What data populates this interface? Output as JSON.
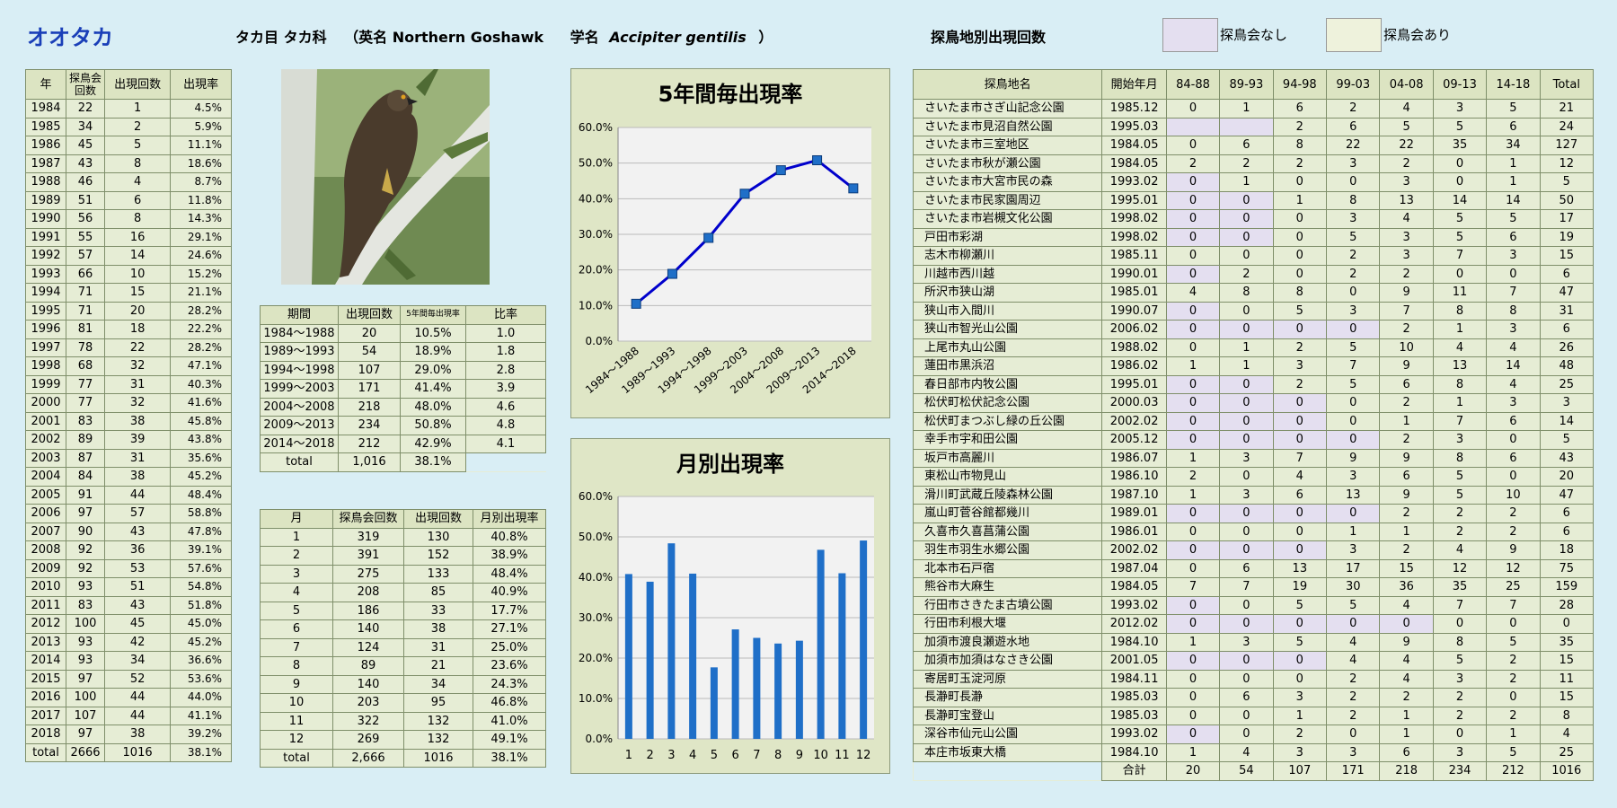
{
  "species": {
    "name": "オオタカ",
    "order_family": "タカ目 タカ科",
    "english_prefix": "（英名 ",
    "english": "Northern Goshawk",
    "latin_prefix": "学名",
    "latin": "Accipiter gentilis",
    "latin_suffix": "）"
  },
  "site_section_title": "探鳥地別出現回数",
  "legend": {
    "no_session": "探鳥会なし",
    "with_session": "探鳥会あり",
    "no_session_color": "#e4dff0",
    "with_session_color": "#eef2dc"
  },
  "yearly": {
    "headers": [
      "年",
      "探鳥会回数",
      "出現回数",
      "出現率"
    ],
    "rows": [
      [
        "1984",
        "22",
        "1",
        "4.5%"
      ],
      [
        "1985",
        "34",
        "2",
        "5.9%"
      ],
      [
        "1986",
        "45",
        "5",
        "11.1%"
      ],
      [
        "1987",
        "43",
        "8",
        "18.6%"
      ],
      [
        "1988",
        "46",
        "4",
        "8.7%"
      ],
      [
        "1989",
        "51",
        "6",
        "11.8%"
      ],
      [
        "1990",
        "56",
        "8",
        "14.3%"
      ],
      [
        "1991",
        "55",
        "16",
        "29.1%"
      ],
      [
        "1992",
        "57",
        "14",
        "24.6%"
      ],
      [
        "1993",
        "66",
        "10",
        "15.2%"
      ],
      [
        "1994",
        "71",
        "15",
        "21.1%"
      ],
      [
        "1995",
        "71",
        "20",
        "28.2%"
      ],
      [
        "1996",
        "81",
        "18",
        "22.2%"
      ],
      [
        "1997",
        "78",
        "22",
        "28.2%"
      ],
      [
        "1998",
        "68",
        "32",
        "47.1%"
      ],
      [
        "1999",
        "77",
        "31",
        "40.3%"
      ],
      [
        "2000",
        "77",
        "32",
        "41.6%"
      ],
      [
        "2001",
        "83",
        "38",
        "45.8%"
      ],
      [
        "2002",
        "89",
        "39",
        "43.8%"
      ],
      [
        "2003",
        "87",
        "31",
        "35.6%"
      ],
      [
        "2004",
        "84",
        "38",
        "45.2%"
      ],
      [
        "2005",
        "91",
        "44",
        "48.4%"
      ],
      [
        "2006",
        "97",
        "57",
        "58.8%"
      ],
      [
        "2007",
        "90",
        "43",
        "47.8%"
      ],
      [
        "2008",
        "92",
        "36",
        "39.1%"
      ],
      [
        "2009",
        "92",
        "53",
        "57.6%"
      ],
      [
        "2010",
        "93",
        "51",
        "54.8%"
      ],
      [
        "2011",
        "83",
        "43",
        "51.8%"
      ],
      [
        "2012",
        "100",
        "45",
        "45.0%"
      ],
      [
        "2013",
        "93",
        "42",
        "45.2%"
      ],
      [
        "2014",
        "93",
        "34",
        "36.6%"
      ],
      [
        "2015",
        "97",
        "52",
        "53.6%"
      ],
      [
        "2016",
        "100",
        "44",
        "44.0%"
      ],
      [
        "2017",
        "107",
        "44",
        "41.1%"
      ],
      [
        "2018",
        "97",
        "38",
        "39.2%"
      ],
      [
        "total",
        "2666",
        "1016",
        "38.1%"
      ]
    ]
  },
  "period": {
    "headers": [
      "期間",
      "出現回数",
      "5年間毎出現率",
      "比率"
    ],
    "rows": [
      [
        "1984～1988",
        "20",
        "10.5%",
        "1.0"
      ],
      [
        "1989～1993",
        "54",
        "18.9%",
        "1.8"
      ],
      [
        "1994～1998",
        "107",
        "29.0%",
        "2.8"
      ],
      [
        "1999～2003",
        "171",
        "41.4%",
        "3.9"
      ],
      [
        "2004～2008",
        "218",
        "48.0%",
        "4.6"
      ],
      [
        "2009～2013",
        "234",
        "50.8%",
        "4.8"
      ],
      [
        "2014～2018",
        "212",
        "42.9%",
        "4.1"
      ]
    ],
    "total": [
      "total",
      "1,016",
      "38.1%"
    ]
  },
  "monthly": {
    "headers": [
      "月",
      "探鳥会回数",
      "出現回数",
      "月別出現率"
    ],
    "rows": [
      [
        "1",
        "319",
        "130",
        "40.8%"
      ],
      [
        "2",
        "391",
        "152",
        "38.9%"
      ],
      [
        "3",
        "275",
        "133",
        "48.4%"
      ],
      [
        "4",
        "208",
        "85",
        "40.9%"
      ],
      [
        "5",
        "186",
        "33",
        "17.7%"
      ],
      [
        "6",
        "140",
        "38",
        "27.1%"
      ],
      [
        "7",
        "124",
        "31",
        "25.0%"
      ],
      [
        "8",
        "89",
        "21",
        "23.6%"
      ],
      [
        "9",
        "140",
        "34",
        "24.3%"
      ],
      [
        "10",
        "203",
        "95",
        "46.8%"
      ],
      [
        "11",
        "322",
        "132",
        "41.0%"
      ],
      [
        "12",
        "269",
        "132",
        "49.1%"
      ],
      [
        "total",
        "2,666",
        "1016",
        "38.1%"
      ]
    ]
  },
  "chart_data": [
    {
      "type": "line",
      "title": "5年間毎出現率",
      "categories": [
        "1984～1988",
        "1989～1993",
        "1994～1998",
        "1999～2003",
        "2004～2008",
        "2009～2013",
        "2014～2018"
      ],
      "values": [
        10.5,
        18.9,
        29.0,
        41.4,
        48.0,
        50.8,
        42.9
      ],
      "ylim": [
        0,
        60
      ],
      "yticks": [
        "0.0%",
        "10.0%",
        "20.0%",
        "30.0%",
        "40.0%",
        "50.0%",
        "60.0%"
      ],
      "color": "#0000cc",
      "marker_color": "#1f6fc8",
      "grid": true
    },
    {
      "type": "bar",
      "title": "月別出現率",
      "categories": [
        "1",
        "2",
        "3",
        "4",
        "5",
        "6",
        "7",
        "8",
        "9",
        "10",
        "11",
        "12"
      ],
      "values": [
        40.8,
        38.9,
        48.4,
        40.9,
        17.7,
        27.1,
        25.0,
        23.6,
        24.3,
        46.8,
        41.0,
        49.1
      ],
      "ylim": [
        0,
        60
      ],
      "yticks": [
        "0.0%",
        "10.0%",
        "20.0%",
        "30.0%",
        "40.0%",
        "50.0%",
        "60.0%"
      ],
      "color": "#1f6fc8",
      "grid": true
    }
  ],
  "sites": {
    "headers": [
      "探鳥地名",
      "開始年月",
      "84-88",
      "89-93",
      "94-98",
      "99-03",
      "04-08",
      "09-13",
      "14-18",
      "Total"
    ],
    "rows": [
      {
        "name": "さいたま市さぎ山記念公園",
        "start": "1985.12",
        "v": [
          "0",
          "1",
          "6",
          "2",
          "4",
          "3",
          "5",
          "21"
        ],
        "none": []
      },
      {
        "name": "さいたま市見沼自然公園",
        "start": "1995.03",
        "v": [
          "",
          "",
          "2",
          "6",
          "5",
          "5",
          "6",
          "24"
        ],
        "none": [
          0,
          1
        ]
      },
      {
        "name": "さいたま市三室地区",
        "start": "1984.05",
        "v": [
          "0",
          "6",
          "8",
          "22",
          "22",
          "35",
          "34",
          "127"
        ],
        "none": []
      },
      {
        "name": "さいたま市秋が瀬公園",
        "start": "1984.05",
        "v": [
          "2",
          "2",
          "2",
          "3",
          "2",
          "0",
          "1",
          "12"
        ],
        "none": []
      },
      {
        "name": "さいたま市大宮市民の森",
        "start": "1993.02",
        "v": [
          "0",
          "1",
          "0",
          "0",
          "3",
          "0",
          "1",
          "5"
        ],
        "none": [
          0
        ]
      },
      {
        "name": "さいたま市民家園周辺",
        "start": "1995.01",
        "v": [
          "0",
          "0",
          "1",
          "8",
          "13",
          "14",
          "14",
          "50"
        ],
        "none": [
          0,
          1
        ]
      },
      {
        "name": "さいたま市岩槻文化公園",
        "start": "1998.02",
        "v": [
          "0",
          "0",
          "0",
          "3",
          "4",
          "5",
          "5",
          "17"
        ],
        "none": [
          0,
          1
        ]
      },
      {
        "name": "戸田市彩湖",
        "start": "1998.02",
        "v": [
          "0",
          "0",
          "0",
          "5",
          "3",
          "5",
          "6",
          "19"
        ],
        "none": [
          0,
          1
        ]
      },
      {
        "name": "志木市柳瀬川",
        "start": "1985.11",
        "v": [
          "0",
          "0",
          "0",
          "2",
          "3",
          "7",
          "3",
          "15"
        ],
        "none": []
      },
      {
        "name": "川越市西川越",
        "start": "1990.01",
        "v": [
          "0",
          "2",
          "0",
          "2",
          "2",
          "0",
          "0",
          "6"
        ],
        "none": [
          0
        ]
      },
      {
        "name": "所沢市狭山湖",
        "start": "1985.01",
        "v": [
          "4",
          "8",
          "8",
          "0",
          "9",
          "11",
          "7",
          "47"
        ],
        "none": []
      },
      {
        "name": "狭山市入間川",
        "start": "1990.07",
        "v": [
          "0",
          "0",
          "5",
          "3",
          "7",
          "8",
          "8",
          "31"
        ],
        "none": [
          0
        ]
      },
      {
        "name": "狭山市智光山公園",
        "start": "2006.02",
        "v": [
          "0",
          "0",
          "0",
          "0",
          "2",
          "1",
          "3",
          "6"
        ],
        "none": [
          0,
          1,
          2,
          3
        ]
      },
      {
        "name": "上尾市丸山公園",
        "start": "1988.02",
        "v": [
          "0",
          "1",
          "2",
          "5",
          "10",
          "4",
          "4",
          "26"
        ],
        "none": []
      },
      {
        "name": "蓮田市黒浜沼",
        "start": "1986.02",
        "v": [
          "1",
          "1",
          "3",
          "7",
          "9",
          "13",
          "14",
          "48"
        ],
        "none": []
      },
      {
        "name": "春日部市内牧公園",
        "start": "1995.01",
        "v": [
          "0",
          "0",
          "2",
          "5",
          "6",
          "8",
          "4",
          "25"
        ],
        "none": [
          0,
          1
        ]
      },
      {
        "name": "松伏町松伏記念公園",
        "start": "2000.03",
        "v": [
          "0",
          "0",
          "0",
          "0",
          "2",
          "1",
          "3",
          "3"
        ],
        "none": [
          0,
          1,
          2
        ]
      },
      {
        "name": "松伏町まつぶし緑の丘公園",
        "start": "2002.02",
        "v": [
          "0",
          "0",
          "0",
          "0",
          "1",
          "7",
          "6",
          "14"
        ],
        "none": [
          0,
          1,
          2
        ]
      },
      {
        "name": "幸手市宇和田公園",
        "start": "2005.12",
        "v": [
          "0",
          "0",
          "0",
          "0",
          "2",
          "3",
          "0",
          "5"
        ],
        "none": [
          0,
          1,
          2,
          3
        ]
      },
      {
        "name": "坂戸市高麗川",
        "start": "1986.07",
        "v": [
          "1",
          "3",
          "7",
          "9",
          "9",
          "8",
          "6",
          "43"
        ],
        "none": []
      },
      {
        "name": "東松山市物見山",
        "start": "1986.10",
        "v": [
          "2",
          "0",
          "4",
          "3",
          "6",
          "5",
          "0",
          "20"
        ],
        "none": []
      },
      {
        "name": "滑川町武蔵丘陵森林公園",
        "start": "1987.10",
        "v": [
          "1",
          "3",
          "6",
          "13",
          "9",
          "5",
          "10",
          "47"
        ],
        "none": []
      },
      {
        "name": "嵐山町菅谷館都幾川",
        "start": "1989.01",
        "v": [
          "0",
          "0",
          "0",
          "0",
          "2",
          "2",
          "2",
          "6"
        ],
        "none": [
          0,
          1,
          2,
          3
        ]
      },
      {
        "name": "久喜市久喜菖蒲公園",
        "start": "1986.01",
        "v": [
          "0",
          "0",
          "0",
          "1",
          "1",
          "2",
          "2",
          "6"
        ],
        "none": []
      },
      {
        "name": "羽生市羽生水郷公園",
        "start": "2002.02",
        "v": [
          "0",
          "0",
          "0",
          "3",
          "2",
          "4",
          "9",
          "18"
        ],
        "none": [
          0,
          1,
          2
        ]
      },
      {
        "name": "北本市石戸宿",
        "start": "1987.04",
        "v": [
          "0",
          "6",
          "13",
          "17",
          "15",
          "12",
          "12",
          "75"
        ],
        "none": []
      },
      {
        "name": "熊谷市大麻生",
        "start": "1984.05",
        "v": [
          "7",
          "7",
          "19",
          "30",
          "36",
          "35",
          "25",
          "159"
        ],
        "none": []
      },
      {
        "name": "行田市さきたま古墳公園",
        "start": "1993.02",
        "v": [
          "0",
          "0",
          "5",
          "5",
          "4",
          "7",
          "7",
          "28"
        ],
        "none": [
          0
        ]
      },
      {
        "name": "行田市利根大堰",
        "start": "2012.02",
        "v": [
          "0",
          "0",
          "0",
          "0",
          "0",
          "0",
          "0",
          "0"
        ],
        "none": [
          0,
          1,
          2,
          3,
          4
        ]
      },
      {
        "name": "加須市渡良瀬遊水地",
        "start": "1984.10",
        "v": [
          "1",
          "3",
          "5",
          "4",
          "9",
          "8",
          "5",
          "35"
        ],
        "none": []
      },
      {
        "name": "加須市加須はなさき公園",
        "start": "2001.05",
        "v": [
          "0",
          "0",
          "0",
          "4",
          "4",
          "5",
          "2",
          "15"
        ],
        "none": [
          0,
          1,
          2
        ]
      },
      {
        "name": "寄居町玉淀河原",
        "start": "1984.11",
        "v": [
          "0",
          "0",
          "0",
          "2",
          "4",
          "3",
          "2",
          "11"
        ],
        "none": []
      },
      {
        "name": "長瀞町長瀞",
        "start": "1985.03",
        "v": [
          "0",
          "6",
          "3",
          "2",
          "2",
          "2",
          "0",
          "15"
        ],
        "none": []
      },
      {
        "name": "長瀞町宝登山",
        "start": "1985.03",
        "v": [
          "0",
          "0",
          "1",
          "2",
          "1",
          "2",
          "2",
          "8"
        ],
        "none": []
      },
      {
        "name": "深谷市仙元山公園",
        "start": "1993.02",
        "v": [
          "0",
          "0",
          "2",
          "0",
          "1",
          "0",
          "1",
          "4"
        ],
        "none": [
          0
        ]
      },
      {
        "name": "本庄市坂東大橋",
        "start": "1984.10",
        "v": [
          "1",
          "4",
          "3",
          "3",
          "6",
          "3",
          "5",
          "25"
        ],
        "none": []
      }
    ],
    "total_label": "合計",
    "totals": [
      "20",
      "54",
      "107",
      "171",
      "218",
      "234",
      "212",
      "1016"
    ]
  }
}
